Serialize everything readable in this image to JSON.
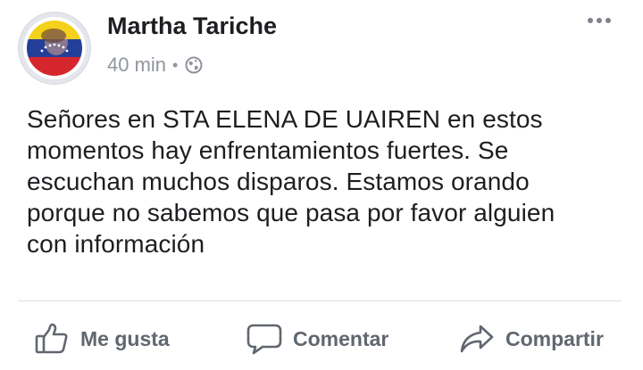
{
  "post": {
    "author": "Martha Tariche",
    "timestamp": "40 min",
    "separator": "•",
    "privacy_icon": "globe-icon",
    "more_icon": "more-options-icon",
    "text": "Señores en STA ELENA DE UAIREN en estos\nmomentos hay enfrentamientos fuertes.  Se\nescuchan muchos disparos. Estamos orando\nporque no sabemos que pasa por favor alguien\ncon  información"
  },
  "actions": {
    "like": {
      "label": "Me gusta",
      "icon": "thumbs-up-icon"
    },
    "comment": {
      "label": "Comentar",
      "icon": "speech-bubble-icon"
    },
    "share": {
      "label": "Compartir",
      "icon": "share-arrow-icon"
    }
  },
  "colors": {
    "text": "#1c1e21",
    "meta": "#90949c",
    "action": "#606770",
    "flag_yellow": "#f4d11b",
    "flag_blue": "#243f9a",
    "flag_red": "#d5262e"
  }
}
